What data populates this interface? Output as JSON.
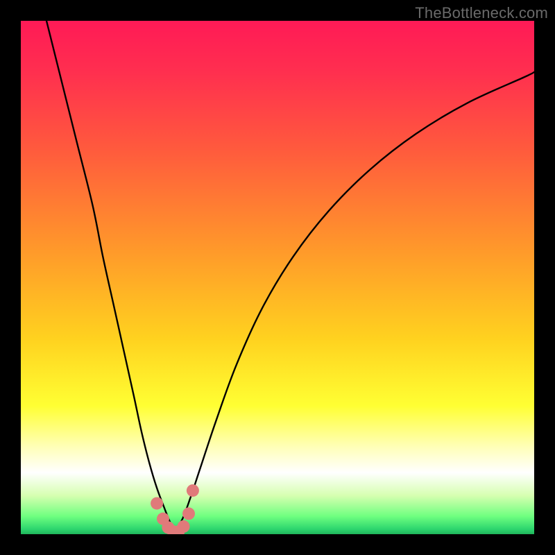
{
  "watermark": "TheBottleneck.com",
  "colors": {
    "frame": "#000000",
    "curve": "#000000",
    "marker_fill": "#e07a7a",
    "marker_stroke": "#c75f5f",
    "gradient_stops": [
      {
        "offset": 0.0,
        "color": "#ff1a56"
      },
      {
        "offset": 0.1,
        "color": "#ff2f4f"
      },
      {
        "offset": 0.25,
        "color": "#ff5a3d"
      },
      {
        "offset": 0.45,
        "color": "#ff9a2a"
      },
      {
        "offset": 0.62,
        "color": "#ffd21f"
      },
      {
        "offset": 0.75,
        "color": "#ffff33"
      },
      {
        "offset": 0.83,
        "color": "#ffffb8"
      },
      {
        "offset": 0.88,
        "color": "#ffffff"
      },
      {
        "offset": 0.925,
        "color": "#d6ffb0"
      },
      {
        "offset": 0.965,
        "color": "#6fff80"
      },
      {
        "offset": 0.99,
        "color": "#2dd66e"
      },
      {
        "offset": 1.0,
        "color": "#1fb45a"
      }
    ]
  },
  "chart_data": {
    "type": "line",
    "title": "",
    "xlabel": "",
    "ylabel": "",
    "xlim": [
      0,
      100
    ],
    "ylim": [
      0,
      100
    ],
    "note": "Axes are implicit percentage scales; no tick labels are rendered in the original image.",
    "series": [
      {
        "name": "left-branch",
        "x": [
          5,
          8,
          11,
          14,
          16,
          18,
          20,
          22,
          23.5,
          25,
          26.5,
          28,
          29,
          30
        ],
        "y": [
          100,
          88,
          76,
          64,
          54,
          45,
          36,
          27,
          20,
          14,
          9,
          5,
          2.5,
          0.5
        ]
      },
      {
        "name": "right-branch",
        "x": [
          30,
          31.5,
          33,
          35,
          38,
          42,
          47,
          53,
          60,
          68,
          77,
          87,
          98,
          100
        ],
        "y": [
          0.5,
          3,
          7,
          13,
          22,
          33,
          44,
          54,
          63,
          71,
          78,
          84,
          89,
          90
        ]
      }
    ],
    "markers": {
      "name": "trough-markers",
      "x": [
        26.5,
        27.7,
        28.7,
        29.7,
        30.7,
        31.7,
        32.7,
        33.5
      ],
      "y": [
        6.0,
        3.0,
        1.3,
        0.5,
        0.5,
        1.5,
        4.0,
        8.5
      ]
    }
  }
}
